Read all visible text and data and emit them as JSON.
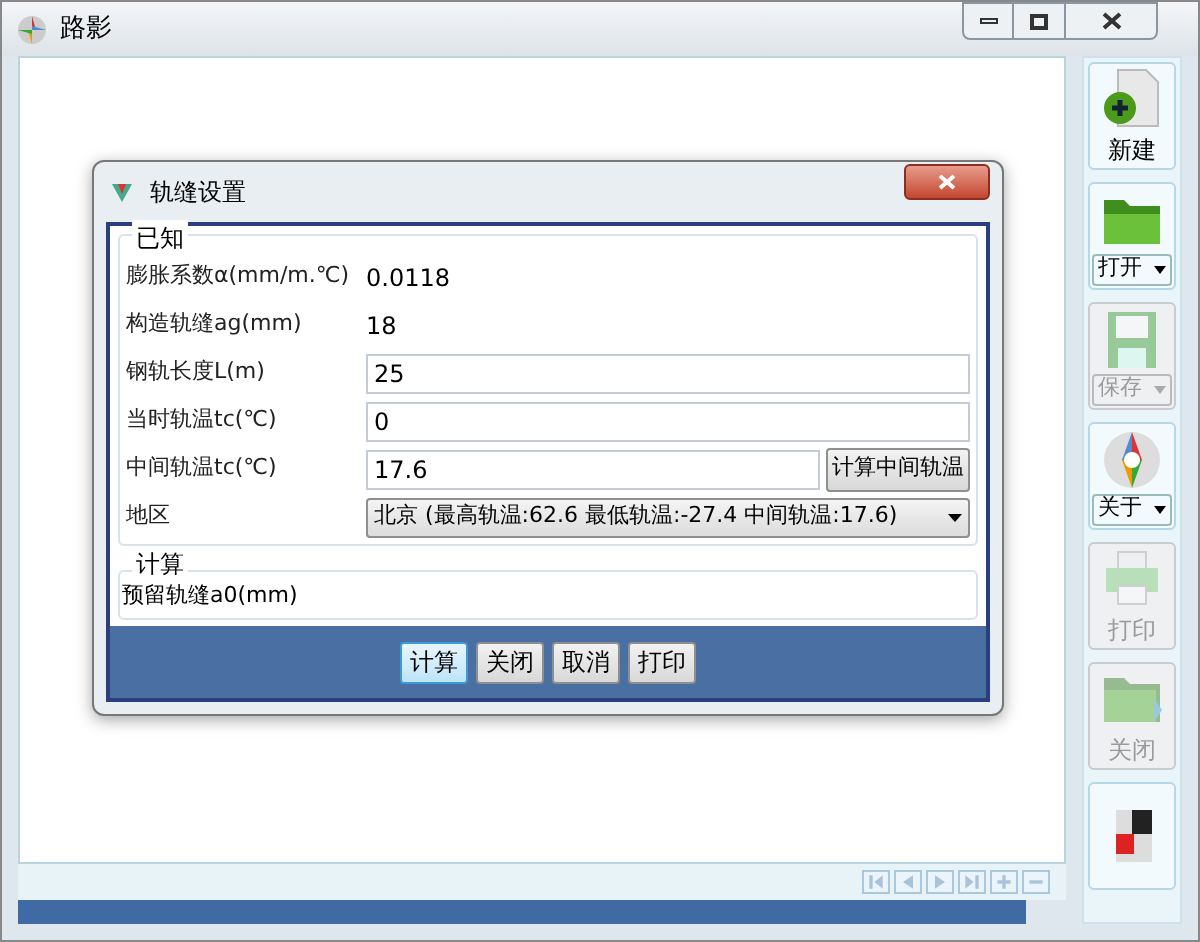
{
  "window": {
    "title": "路影"
  },
  "toolbar": [
    {
      "label": "新建",
      "kind": "plain",
      "disabled": false
    },
    {
      "label": "打开",
      "kind": "dropdown",
      "disabled": false
    },
    {
      "label": "保存",
      "kind": "dropdown",
      "disabled": true
    },
    {
      "label": "关于",
      "kind": "dropdown",
      "disabled": false
    },
    {
      "label": "打印",
      "kind": "plain",
      "disabled": true
    },
    {
      "label": "关闭",
      "kind": "plain",
      "disabled": true
    },
    {
      "kind": "icon_only",
      "disabled": false
    }
  ],
  "dialog": {
    "title": "轨缝设置",
    "known_group": {
      "legend": "已知",
      "rows": [
        {
          "kind": "static",
          "label": "膨胀系数α(mm/m.℃)",
          "value": "0.0118"
        },
        {
          "kind": "static",
          "label": "构造轨缝ag(mm)",
          "value": "18"
        },
        {
          "kind": "input",
          "label": "钢轨长度L(m)",
          "value": "25"
        },
        {
          "kind": "input",
          "label": "当时轨温tc(℃)",
          "value": "0"
        },
        {
          "kind": "input_button",
          "label": "中间轨温tc(℃)",
          "value": "17.6",
          "button": "计算中间轨温"
        },
        {
          "kind": "select",
          "label": "地区",
          "value": "北京 (最高轨温:62.6 最低轨温:-27.4 中间轨温:17.6)"
        }
      ]
    },
    "result_group": {
      "legend": "计算",
      "label": "预留轨缝a0(mm)"
    },
    "buttons": [
      {
        "label": "计算",
        "selected": true
      },
      {
        "label": "关闭",
        "selected": false
      },
      {
        "label": "取消",
        "selected": false
      },
      {
        "label": "打印",
        "selected": false
      }
    ]
  }
}
